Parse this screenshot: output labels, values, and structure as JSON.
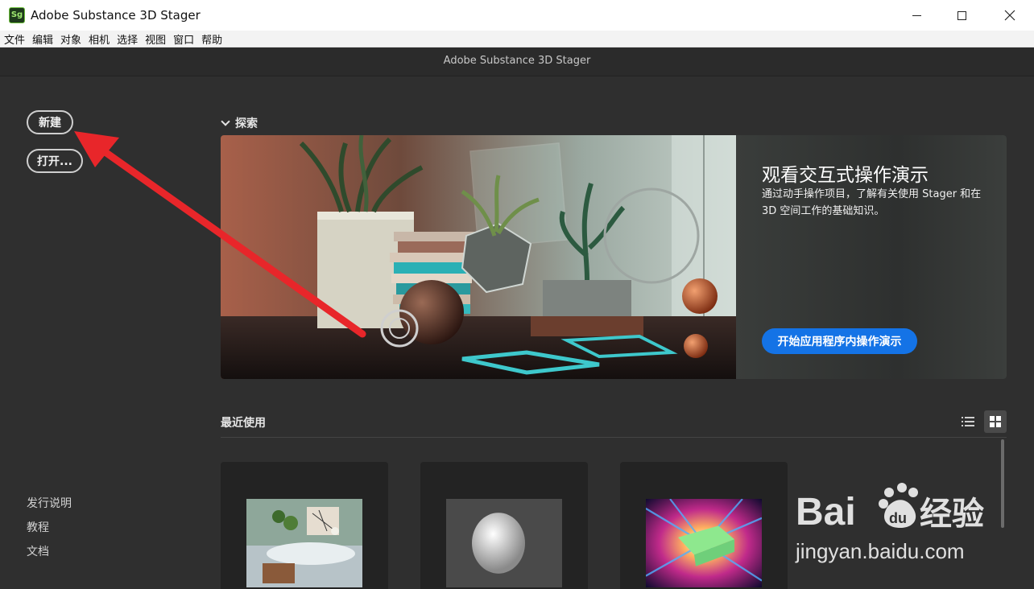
{
  "window": {
    "app_icon_text": "Sg",
    "title": "Adobe Substance 3D Stager",
    "controls": [
      "minimize-icon",
      "maximize-icon",
      "close-icon"
    ]
  },
  "menubar": {
    "items": [
      "文件",
      "编辑",
      "对象",
      "相机",
      "选择",
      "视图",
      "窗口",
      "帮助"
    ]
  },
  "app_header": {
    "title": "Adobe Substance 3D Stager"
  },
  "sidebar": {
    "new_label": "新建",
    "open_label": "打开...",
    "links": [
      "发行说明",
      "教程",
      "文档"
    ]
  },
  "explore": {
    "section_label": "探索",
    "banner": {
      "title": "观看交互式操作演示",
      "description": "通过动手操作项目，了解有关使用 Stager 和在 3D 空间工作的基础知识。",
      "cta_label": "开始应用程序内操作演示"
    }
  },
  "recent": {
    "section_label": "最近使用",
    "view_modes": [
      "list-view-icon",
      "grid-view-icon"
    ],
    "active_view": "grid"
  },
  "watermark": {
    "brand": "Bai",
    "brand_suffix": "du",
    "cn_text": "经验",
    "url": "jingyan.baidu.com"
  },
  "colors": {
    "accent": "#1473e6",
    "annotation_arrow": "#e8262a",
    "app_bg": "#2f2f2f"
  }
}
